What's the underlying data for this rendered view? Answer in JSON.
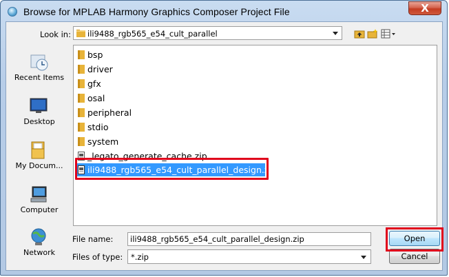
{
  "window": {
    "title": "Browse for MPLAB Harmony Graphics Composer Project File",
    "close_label": "X"
  },
  "look_in": {
    "label": "Look in:",
    "value": "ili9488_rgb565_e54_cult_parallel"
  },
  "places": [
    {
      "label": "Recent Items",
      "icon": "recent-items-icon"
    },
    {
      "label": "Desktop",
      "icon": "desktop-icon"
    },
    {
      "label": "My Docum...",
      "icon": "my-documents-icon"
    },
    {
      "label": "Computer",
      "icon": "computer-icon"
    },
    {
      "label": "Network",
      "icon": "network-icon"
    }
  ],
  "files": [
    {
      "name": "bsp",
      "kind": "folder"
    },
    {
      "name": "driver",
      "kind": "folder"
    },
    {
      "name": "gfx",
      "kind": "folder"
    },
    {
      "name": "osal",
      "kind": "folder"
    },
    {
      "name": "peripheral",
      "kind": "folder"
    },
    {
      "name": "stdio",
      "kind": "folder"
    },
    {
      "name": "system",
      "kind": "folder"
    },
    {
      "name": "_legato_generate_cache.zip",
      "kind": "zip"
    },
    {
      "name": "ili9488_rgb565_e54_cult_parallel_design.zip",
      "kind": "zip",
      "selected": true
    }
  ],
  "file_name": {
    "label": "File name:",
    "value": "ili9488_rgb565_e54_cult_parallel_design.zip"
  },
  "files_of_type": {
    "label": "Files of type:",
    "value": "*.zip"
  },
  "buttons": {
    "open": "Open",
    "cancel": "Cancel"
  },
  "colors": {
    "selection": "#3399ff",
    "highlight_box": "#e0001b",
    "folder": "#e8b43a"
  }
}
